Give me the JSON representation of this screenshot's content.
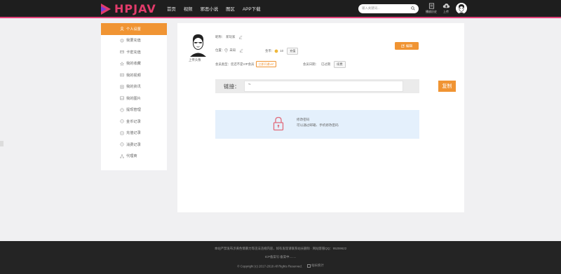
{
  "header": {
    "logo_text": "HPJAV",
    "nav": [
      "首页",
      "视频",
      "邪恶小说",
      "图区",
      "APP下载"
    ],
    "search_placeholder": "输入关键词...",
    "history_label": "播放历史",
    "upload_label": "上传"
  },
  "sidebar": {
    "items": [
      {
        "label": "个人设置",
        "icon": "user-icon"
      },
      {
        "label": "我要充值",
        "icon": "coin-icon"
      },
      {
        "label": "卡密充值",
        "icon": "card-icon"
      },
      {
        "label": "我的收藏",
        "icon": "star-icon"
      },
      {
        "label": "我的视频",
        "icon": "video-icon"
      },
      {
        "label": "我的资讯",
        "icon": "news-icon"
      },
      {
        "label": "我的图片",
        "icon": "image-icon"
      },
      {
        "label": "提现管理",
        "icon": "withdraw-icon"
      },
      {
        "label": "金币记录",
        "icon": "gold-log-icon"
      },
      {
        "label": "充值记录",
        "icon": "recharge-log-icon"
      },
      {
        "label": "消费记录",
        "icon": "spend-log-icon"
      },
      {
        "label": "代理商",
        "icon": "agent-icon"
      }
    ]
  },
  "profile": {
    "avatar_caption": "上传头像",
    "nickname_label": "昵称：",
    "nickname": "新玩家",
    "location_label": "位置：",
    "location": "未知",
    "coins_label": "金币：",
    "coins": "10",
    "recharge_btn": "充值",
    "member_type_label": "会员类型：",
    "member_type": "您还不是VIP会员",
    "vip_btn": "立即开通VIP",
    "expire_label": "会员日期：",
    "expire": "已过期",
    "renew_btn": "续费",
    "edit_btn": "编辑"
  },
  "share": {
    "label": "链接：",
    "value": "~",
    "copy_btn": "复制"
  },
  "notice": {
    "title": "修改密码",
    "text": "可以通过邮箱、手机修改密码"
  },
  "footer": {
    "line1": "本站严禁发布涉黄色情暴力等违法违规内容，如有发现请联系站长删除 · 网站客服QQ：95259622",
    "line2": "ICP备案号:备案中........",
    "copyright": "© Copyright (c) 2017-2018 All Rights Reserved.",
    "stats_img_alt": "站长统计"
  },
  "colors": {
    "accent": "#f09433",
    "brand": "#e23b6b",
    "header_bg": "#1e1e1e",
    "notice_bg": "#e4f0fc"
  }
}
